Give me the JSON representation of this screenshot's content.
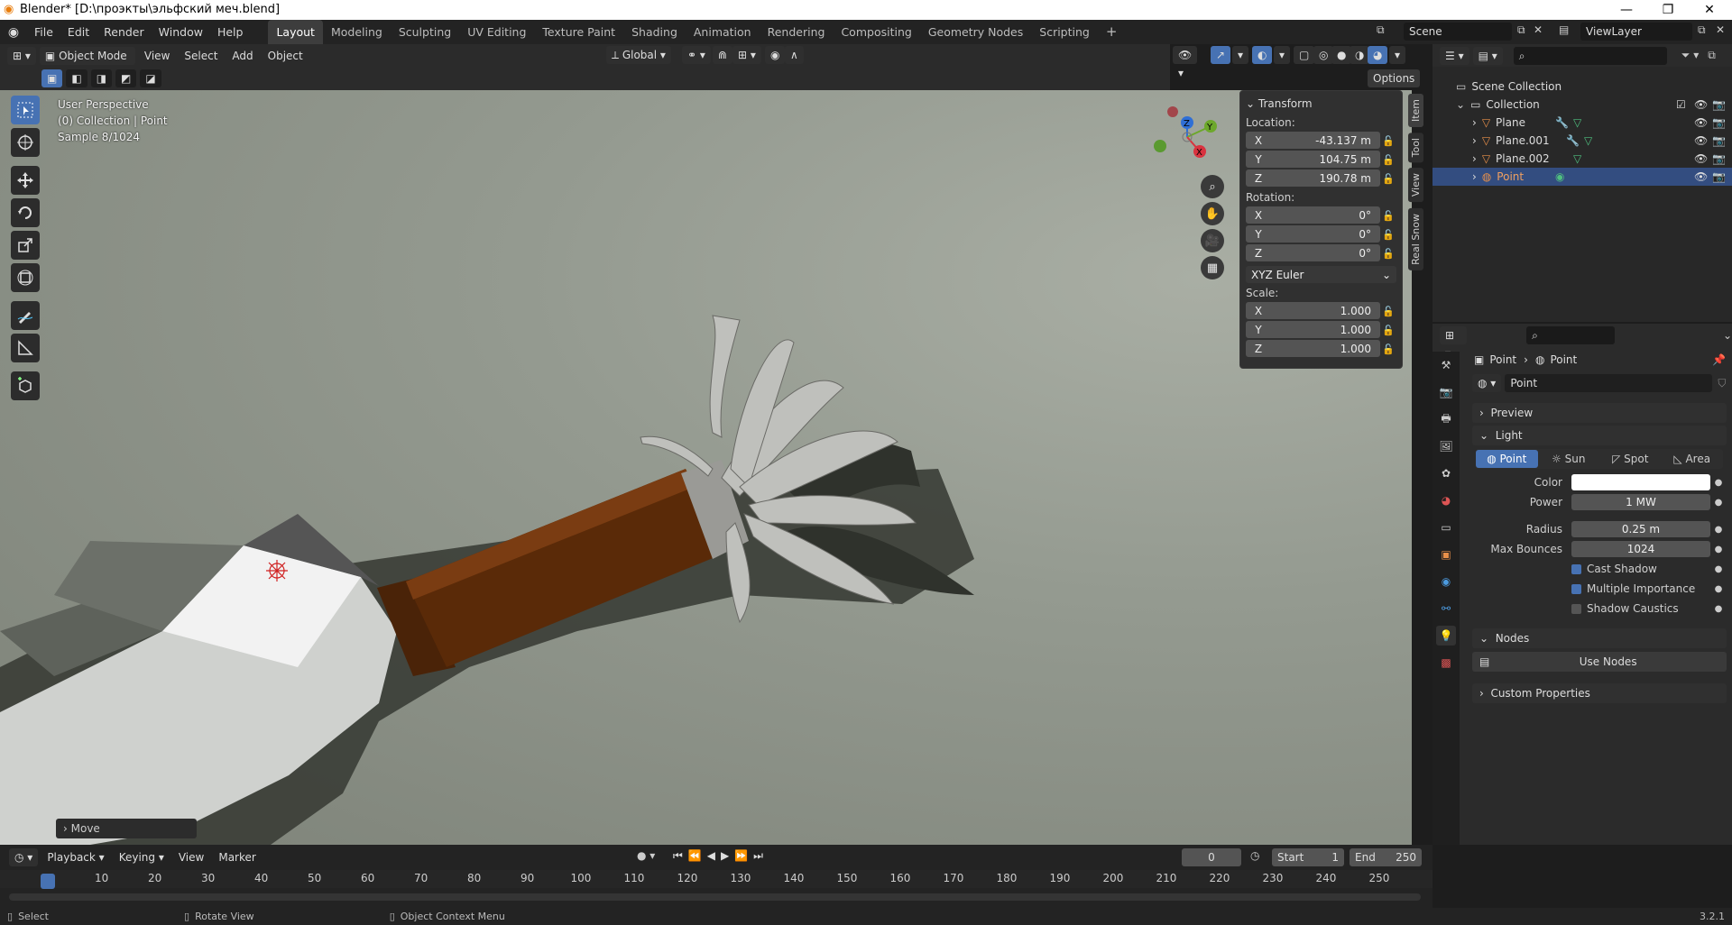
{
  "window": {
    "title": "Blender* [D:\\проэкты\\эльфский меч.blend]"
  },
  "menu": [
    "File",
    "Edit",
    "Render",
    "Window",
    "Help"
  ],
  "workspaces": [
    "Layout",
    "Modeling",
    "Sculpting",
    "UV Editing",
    "Texture Paint",
    "Shading",
    "Animation",
    "Rendering",
    "Compositing",
    "Geometry Nodes",
    "Scripting"
  ],
  "active_workspace": "Layout",
  "scene": "Scene",
  "view_layer": "ViewLayer",
  "viewport_header": {
    "mode": "Object Mode",
    "menus": [
      "View",
      "Select",
      "Add",
      "Object"
    ],
    "orientation": "Global",
    "options": "Options"
  },
  "overlay_text": {
    "perspective": "User Perspective",
    "collection": "(0) Collection | Point",
    "sample": "Sample 8/1024"
  },
  "operator_panel": "Move",
  "transform": {
    "title": "Transform",
    "location_label": "Location:",
    "location": [
      {
        "axis": "X",
        "value": "-43.137 m"
      },
      {
        "axis": "Y",
        "value": "104.75 m"
      },
      {
        "axis": "Z",
        "value": "190.78 m"
      }
    ],
    "rotation_label": "Rotation:",
    "rotation": [
      {
        "axis": "X",
        "value": "0°"
      },
      {
        "axis": "Y",
        "value": "0°"
      },
      {
        "axis": "Z",
        "value": "0°"
      }
    ],
    "rotation_mode": "XYZ Euler",
    "scale_label": "Scale:",
    "scale": [
      {
        "axis": "X",
        "value": "1.000"
      },
      {
        "axis": "Y",
        "value": "1.000"
      },
      {
        "axis": "Z",
        "value": "1.000"
      }
    ]
  },
  "side_tabs": [
    "Item",
    "Tool",
    "View",
    "Real Snow"
  ],
  "gizmo": {
    "z": "Z",
    "y": "Y",
    "x": "X"
  },
  "outliner": {
    "root": "Scene Collection",
    "collection": "Collection",
    "items": [
      {
        "name": "Plane"
      },
      {
        "name": "Plane.001"
      },
      {
        "name": "Plane.002"
      },
      {
        "name": "Point"
      }
    ]
  },
  "properties": {
    "breadcrumb": [
      "Point",
      "Point"
    ],
    "datablock": "Point",
    "sections": {
      "preview": "Preview",
      "light": "Light",
      "nodes": "Nodes",
      "custom": "Custom Properties"
    },
    "light_types": [
      "Point",
      "Sun",
      "Spot",
      "Area"
    ],
    "active_light_type": "Point",
    "fields": [
      {
        "label": "Color",
        "value": ""
      },
      {
        "label": "Power",
        "value": "1 MW"
      },
      {
        "label": "Radius",
        "value": "0.25 m"
      },
      {
        "label": "Max Bounces",
        "value": "1024"
      }
    ],
    "checks": [
      {
        "label": "Cast Shadow",
        "on": true
      },
      {
        "label": "Multiple Importance",
        "on": true
      },
      {
        "label": "Shadow Caustics",
        "on": false
      }
    ],
    "use_nodes": "Use Nodes"
  },
  "timeline": {
    "menus": [
      "Playback",
      "Keying",
      "View",
      "Marker"
    ],
    "current_frame": "0",
    "start_label": "Start",
    "start": "1",
    "end_label": "End",
    "end": "250",
    "ticks": [
      "0",
      "10",
      "20",
      "30",
      "40",
      "50",
      "60",
      "70",
      "80",
      "90",
      "100",
      "110",
      "120",
      "130",
      "140",
      "150",
      "160",
      "170",
      "180",
      "190",
      "200",
      "210",
      "220",
      "230",
      "240",
      "250"
    ]
  },
  "status": {
    "select": "Select",
    "rotate": "Rotate View",
    "context": "Object Context Menu",
    "version": "3.2.1"
  },
  "colors": {
    "accent": "#4772b3",
    "handle": "#5a2a08",
    "blade": "#d6d6d6",
    "light_color": "#ffffff"
  }
}
